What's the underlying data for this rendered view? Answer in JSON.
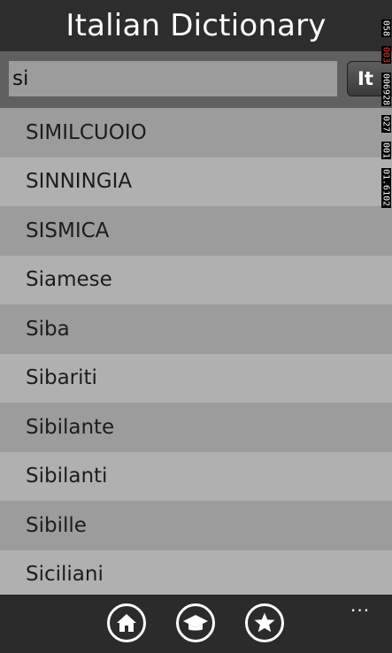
{
  "header": {
    "title": "Italian Dictionary"
  },
  "search": {
    "value": "si",
    "language_button": "It"
  },
  "results": [
    "SIMILCUOIO",
    "SINNINGIA",
    "SISMICA",
    "Siamese",
    "Siba",
    "Sibariti",
    "Sibilante",
    "Sibilanti",
    "Sibille",
    "Siciliani"
  ],
  "app_bar": {
    "buttons": [
      {
        "name": "home",
        "icon": "home-icon"
      },
      {
        "name": "learn",
        "icon": "graduation-cap-icon"
      },
      {
        "name": "favorites",
        "icon": "star-icon"
      }
    ],
    "more": "..."
  },
  "debug_counters": [
    "058",
    "003",
    "006928",
    "027",
    "001",
    "01.6102"
  ]
}
